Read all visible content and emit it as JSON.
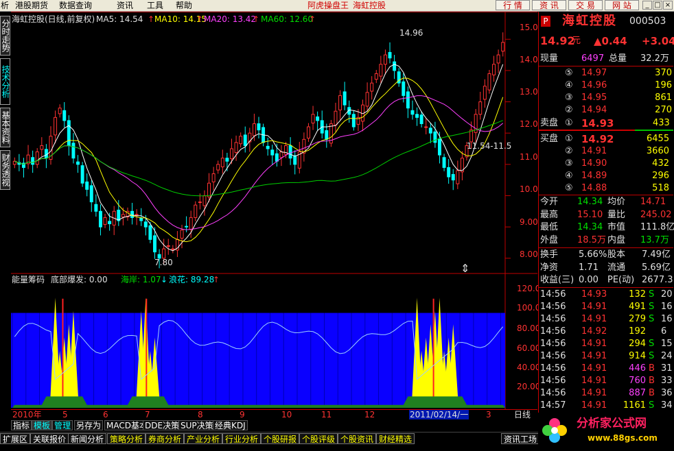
{
  "menu": {
    "items": [
      "析",
      "港股期货",
      "数据查询",
      "资讯",
      "工具",
      "帮助"
    ],
    "app_title": "阿虎操盘王",
    "stock_title": "海虹控股",
    "buttons": [
      "行 情",
      "资 讯",
      "交 易",
      "网 站"
    ],
    "window_controls": [
      "_",
      "□",
      "×"
    ]
  },
  "left_tabs": [
    "分时走势",
    "技术分析",
    "基本资料",
    "财务透视"
  ],
  "chart_header": {
    "name": "海虹控股(日线,前复权)",
    "ma5": "MA5: 14.54",
    "ma10": "MA10: 14.15",
    "ma20": "MA20: 13.42",
    "ma60": "MA60: 12.60",
    "arrow": "↑"
  },
  "indicator_header": {
    "name": "能量筹码",
    "bottom": "底部爆发: 0.00",
    "shore": "海岸: 1.07",
    "shore_arrow": "↓",
    "wave": "浪花: 89.28",
    "wave_arrow": "↑"
  },
  "annotations": {
    "high": "14.96",
    "low": "7.80",
    "range": "11.54-11.5"
  },
  "price_axis": [
    "15.00",
    "14.00",
    "13.00",
    "12.00",
    "11.00",
    "10.00",
    "9.00",
    "8.00"
  ],
  "ind_axis": [
    "120.0",
    "100.0",
    "80.00",
    "60.00",
    "40.00",
    "20.00"
  ],
  "dates": {
    "year": "2010年",
    "months": [
      "5",
      "6",
      "7",
      "8",
      "9",
      "10",
      "11",
      "12"
    ],
    "cursor": "2011/02/14/一",
    "end_month": "3",
    "period": "日线"
  },
  "toolbar1": [
    "指标",
    "模板",
    "管理",
    "另存为",
    "MACD基本",
    "DDE决策",
    "SUP决策",
    "经典KDJ"
  ],
  "toolbar2": [
    "扩展区",
    "关联报价",
    "新闻分析",
    "策略分析",
    "券商分析",
    "产业分析",
    "行业分析",
    "个股研报",
    "个股评级",
    "个股资讯",
    "财经精选",
    "资讯工场"
  ],
  "quote": {
    "badge": "P",
    "name": "海虹控股",
    "code": "000503",
    "price": "14.92",
    "unit": "元",
    "change": "▲0.44",
    "pct": "+3.04",
    "now_vol_label": "现量",
    "now_vol": "6497",
    "total_vol_label": "总量",
    "total_vol": "32.2万",
    "sells": [
      {
        "n": "⑤",
        "p": "14.97",
        "v": "370"
      },
      {
        "n": "④",
        "p": "14.96",
        "v": "196"
      },
      {
        "n": "③",
        "p": "14.95",
        "v": "861"
      },
      {
        "n": "②",
        "p": "14.94",
        "v": "270"
      }
    ],
    "sell1_label": "卖盘",
    "sell1_n": "①",
    "sell1_p": "14.93",
    "sell1_v": "433",
    "buy1_label": "买盘",
    "buy1_n": "①",
    "buy1_p": "14.92",
    "buy1_v": "6455",
    "buys": [
      {
        "n": "②",
        "p": "14.91",
        "v": "3660"
      },
      {
        "n": "③",
        "p": "14.90",
        "v": "432"
      },
      {
        "n": "④",
        "p": "14.89",
        "v": "296"
      },
      {
        "n": "⑤",
        "p": "14.88",
        "v": "518"
      }
    ],
    "stats": [
      {
        "l1": "今开",
        "v1": "14.34",
        "c1": "green",
        "l2": "均价",
        "v2": "14.71",
        "c2": "red"
      },
      {
        "l1": "最高",
        "v1": "15.10",
        "c1": "red",
        "l2": "量比",
        "v2": "245.02",
        "c2": "red"
      },
      {
        "l1": "最低",
        "v1": "14.34",
        "c1": "green",
        "l2": "市值",
        "v2": "111.8亿",
        "c2": "white"
      },
      {
        "l1": "外盘",
        "v1": "18.5万",
        "c1": "red",
        "l2": "内盘",
        "v2": "13.7万",
        "c2": "green"
      }
    ],
    "stats2": [
      {
        "l1": "换手",
        "v1": "5.66%",
        "l2": "股本",
        "v2": "7.49亿"
      },
      {
        "l1": "净资",
        "v1": "1.71",
        "l2": "流通",
        "v2": "5.69亿"
      },
      {
        "l1": "收益(三)",
        "v1": "0.00",
        "l2": "PE(动)",
        "v2": "2677.3"
      }
    ],
    "ticks": [
      {
        "t": "14:56",
        "p": "14.93",
        "v": "132",
        "s": "S",
        "n": "20"
      },
      {
        "t": "14:56",
        "p": "14.91",
        "v": "491",
        "s": "S",
        "n": "16"
      },
      {
        "t": "14:56",
        "p": "14.91",
        "v": "279",
        "s": "S",
        "n": "16"
      },
      {
        "t": "14:56",
        "p": "14.92",
        "v": "192",
        "s": "",
        "n": "6"
      },
      {
        "t": "14:56",
        "p": "14.91",
        "v": "294",
        "s": "S",
        "n": "15"
      },
      {
        "t": "14:56",
        "p": "14.91",
        "v": "914",
        "s": "S",
        "n": "24"
      },
      {
        "t": "14:56",
        "p": "14.91",
        "v": "446",
        "s": "B",
        "n": "31"
      },
      {
        "t": "14:56",
        "p": "14.91",
        "v": "760",
        "s": "B",
        "n": "33"
      },
      {
        "t": "14:56",
        "p": "14.91",
        "v": "887",
        "s": "B",
        "n": "36"
      },
      {
        "t": "14:57",
        "p": "14.91",
        "v": "1161",
        "s": "S",
        "n": "34"
      }
    ]
  },
  "logo": {
    "name": "分析家公式网",
    "url": "www.88gs.com"
  },
  "colors": {
    "up": "#ff3232",
    "down": "#00ffff",
    "ma5": "#ffffff",
    "ma10": "#ffff00",
    "ma20": "#ff40ff",
    "ma60": "#00d000",
    "ind_bg": "#0a00ff"
  },
  "chart_data": {
    "type": "candlestick",
    "price_ylim": [
      7.6,
      15.4
    ],
    "close_series": [
      11.1,
      11.0,
      10.9,
      11.3,
      11.0,
      11.4,
      11.6,
      11.2,
      11.9,
      12.5,
      12.8,
      12.4,
      11.6,
      11.2,
      11.0,
      10.4,
      10.2,
      9.8,
      9.5,
      9.0,
      9.3,
      9.1,
      9.5,
      9.2,
      9.4,
      9.5,
      9.3,
      9.4,
      9.2,
      9.0,
      8.6,
      8.2,
      8.0,
      8.3,
      8.4,
      8.3,
      8.6,
      8.9,
      9.0,
      9.3,
      9.7,
      9.8,
      10.0,
      10.4,
      10.7,
      11.0,
      11.2,
      11.1,
      11.5,
      11.7,
      11.9,
      11.6,
      12.0,
      12.3,
      12.1,
      11.7,
      11.5,
      11.3,
      11.1,
      11.4,
      11.6,
      11.2,
      11.0,
      11.4,
      11.8,
      12.2,
      12.6,
      12.4,
      12.0,
      11.8,
      12.3,
      12.7,
      13.2,
      12.9,
      12.6,
      12.2,
      12.5,
      12.9,
      13.3,
      13.6,
      13.9,
      14.2,
      14.5,
      14.4,
      14.0,
      13.6,
      13.2,
      12.8,
      12.6,
      12.5,
      12.3,
      12.2,
      12.0,
      11.7,
      11.3,
      10.9,
      10.6,
      10.5,
      10.8,
      11.2,
      11.6,
      12.1,
      12.6,
      13.0,
      13.5,
      13.9,
      14.2,
      14.5,
      14.9
    ],
    "ind_ylim": [
      0,
      130
    ],
    "ind_base": 100
  }
}
